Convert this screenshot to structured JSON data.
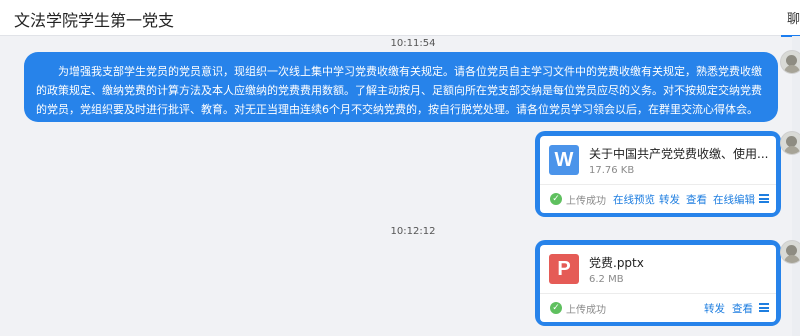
{
  "header": {
    "title": "文法学院学生第一党支",
    "right_label": "聊"
  },
  "messages": {
    "ts1": "10:11:54",
    "text1": "为增强我支部学生党员的党员意识，现组织一次线上集中学习党费收缴有关规定。请各位党员自主学习文件中的党费收缴有关规定，熟悉党费收缴的政策规定、缴纳党费的计算方法及本人应缴纳的党费费用数额。了解主动按月、足额向所在党支部交纳是每位党员应尽的义务。对不按规定交纳党费的党员，党组织要及时进行批评、教育。对无正当理由连续6个月不交纳党费的，按自行脱党处理。请各位党员学习领会以后，在群里交流心得体会。",
    "ts2": "10:12:12"
  },
  "file1": {
    "icon": "word-doc-icon",
    "icon_letter": "W",
    "name": "关于中国共产党党费收缴、使用...",
    "size": "17.76 KB",
    "status": "上传成功",
    "actions": [
      "在线预览",
      "转发",
      "查看",
      "在线编辑"
    ]
  },
  "file2": {
    "icon": "ppt-doc-icon",
    "icon_letter": "P",
    "name": "党费.pptx",
    "size": "6.2 MB",
    "status": "上传成功",
    "actions": [
      "转发",
      "查看"
    ]
  },
  "colors": {
    "bubble": "#2783ea",
    "link": "#1e7ee0",
    "success": "#5fc05f",
    "word": "#4b94ea",
    "ppt": "#e55b56"
  }
}
